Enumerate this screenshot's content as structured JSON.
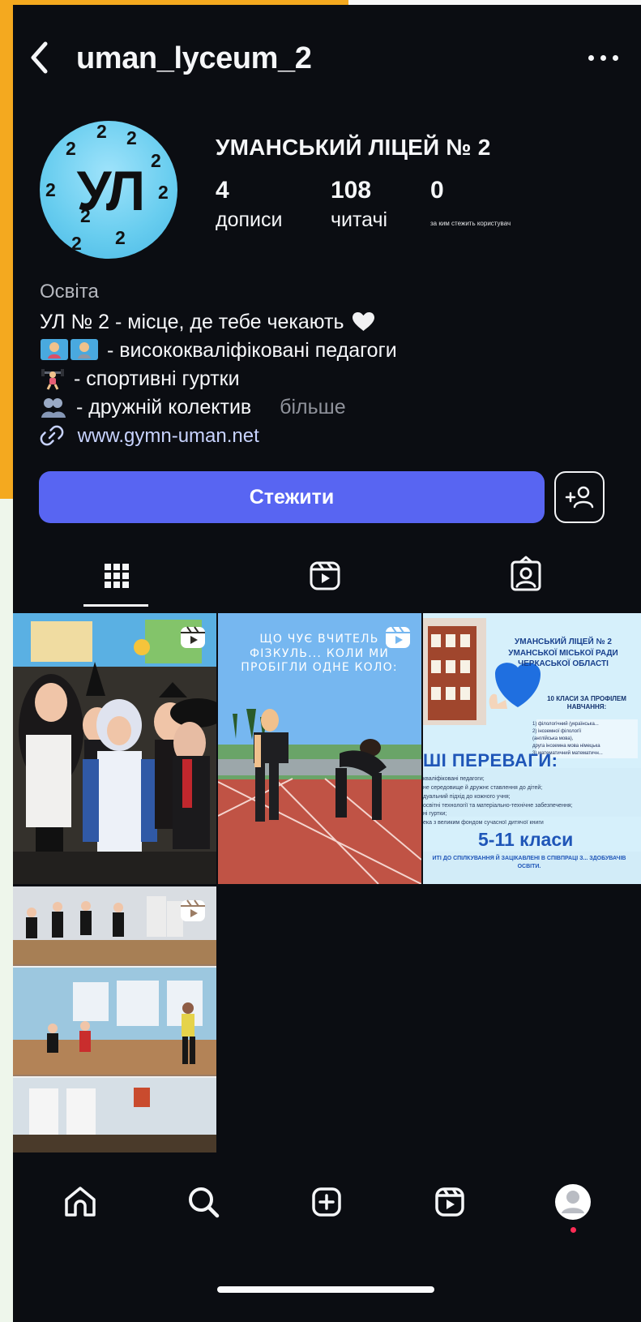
{
  "app": {
    "accent_color": "#5865f2"
  },
  "header": {
    "username": "uman_lyceum_2",
    "back_icon": "chevron-left-icon",
    "more_icon": "more-horizontal-icon"
  },
  "profile": {
    "display_name": "УМАНСЬКИЙ ЛІЦЕЙ № 2",
    "avatar_text": "УЛ",
    "avatar_digit": "2",
    "stats": [
      {
        "value": "4",
        "label": "дописи"
      },
      {
        "value": "108",
        "label": "читачі"
      },
      {
        "value": "0",
        "label": "за ким стежить користувач"
      }
    ],
    "bio": {
      "category": "Освіта",
      "line_1": "УЛ № 2 - місце, де тебе чекають",
      "line_2": "- висококваліфіковані педагоги",
      "line_3": "- спортивні гуртки",
      "line_4": "- дружній колектив",
      "more": "більше"
    },
    "website": "www.gymn-uman.net"
  },
  "actions": {
    "follow_label": "Стежити",
    "add_user_icon": "add-user-icon"
  },
  "tabs": [
    {
      "name": "grid",
      "icon": "grid-icon",
      "active": true
    },
    {
      "name": "reels",
      "icon": "reels-icon",
      "active": false
    },
    {
      "name": "tagged",
      "icon": "tagged-icon",
      "active": false
    }
  ],
  "posts": {
    "post_2": {
      "caption": "ЩО ЧУЄ ВЧИТЕЛЬ ФІЗКУЛЬ... КОЛИ МИ ПРОБІГЛИ ОДНЕ КОЛО:"
    },
    "post_3": {
      "title": "УМАНСЬКИЙ ЛІЦЕЙ № 2 УМАНСЬКОЇ МІСЬКОЇ РАДИ ЧЕРКАСЬКОЇ ОБЛАСТІ",
      "subtitle": "10 КЛАСИ ЗА ПРОФІЛЕМ НАВЧАННЯ:",
      "list": [
        "1) філологічний (українська...",
        "2) іноземної філології",
        "(англійська мова),",
        "друга іноземна мова німецька",
        "3) математичний математичн..."
      ],
      "advantages": "ШІ ПЕРЕВАГИ:",
      "benefits": [
        "кваліфіковані педагоги;",
        "не середовище й дружнє ставлення до дітей;",
        "дуальний підхід до кожного учня;",
        "освітні технології та матеріально-технічне забезпечення;",
        "ні гуртки;",
        "ека з великим фондом сучасної дитячої книги"
      ],
      "grades": "5-11 класи",
      "bottom": "ИТІ ДО СПІЛКУВАННЯ Й ЗАЦІКАВЛЕНІ В СПІВПРАЦІ З... ЗДОБУВАЧІВ ОСВІТИ."
    }
  },
  "bottom_nav": [
    {
      "name": "home",
      "icon": "home-icon"
    },
    {
      "name": "search",
      "icon": "search-icon"
    },
    {
      "name": "create",
      "icon": "add-square-icon"
    },
    {
      "name": "reels",
      "icon": "reels-icon"
    },
    {
      "name": "profile",
      "icon": "profile-avatar-icon"
    }
  ]
}
